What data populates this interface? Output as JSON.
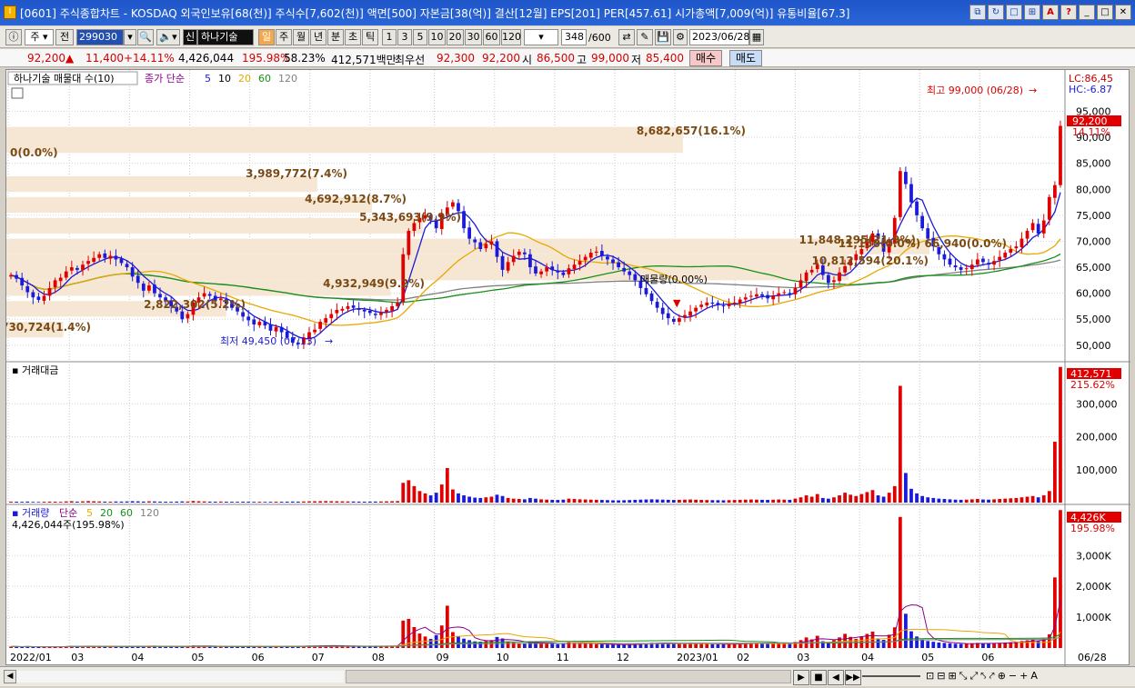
{
  "window": {
    "title": "[0601] 주식종합차트 - KOSDAQ 외국인보유[68(천)] 주식수[7,602(천)] 액면[500] 자본금[38(억)] 결산[12월] EPS[201] PER[457.61] 시가총액[7,009(억)] 유통비율[67.3]",
    "app_icon": "I"
  },
  "toolbar": {
    "type_select": "주",
    "prev_label": "전",
    "stock_code": "299030",
    "company_badge": "신",
    "company_name": "하나기술",
    "periods": [
      "일",
      "주",
      "월",
      "년",
      "분",
      "초",
      "틱"
    ],
    "active_period": "일",
    "intervals": [
      "1",
      "3",
      "5",
      "10",
      "20",
      "30",
      "60",
      "120"
    ],
    "count_value": "348",
    "count_max": "/600",
    "date_value": "2023/06/28"
  },
  "quote": {
    "price": "92,200",
    "change": "11,400",
    "change_pct": "+14.11%",
    "volume": "4,426,044",
    "volume_ratio": "195.98%",
    "turnover": "58.23%",
    "amount": "412,571백만",
    "best_label": "최우선",
    "best_ask": "92,300",
    "best_bid": "92,200",
    "open_label": "시",
    "open": "86,500",
    "high_label": "고",
    "high": "99,000",
    "low_label": "저",
    "low": "85,400",
    "buy_label": "매수",
    "sell_label": "매도"
  },
  "colors": {
    "up": "#e00000",
    "down": "#1a1ad8",
    "ma5": "#1a1ad8",
    "ma10": "#ffffff",
    "ma20": "#e8a800",
    "ma60": "#189018",
    "ma120": "#808080",
    "volume_profile": "#f6e7d5",
    "volume_profile_text": "#7a4a14"
  },
  "chart_data": [
    {
      "type": "candlestick",
      "title": "하나기술 매물대 수(10)",
      "legend": {
        "label": "종가 단순",
        "periods": [
          "5",
          "10",
          "20",
          "60",
          "120"
        ]
      },
      "price_axis_ticks": [
        "95,000",
        "90,000",
        "85,000",
        "80,000",
        "75,000",
        "70,000",
        "65,000",
        "60,000",
        "55,000",
        "50,000"
      ],
      "ylim": [
        47000,
        100500
      ],
      "x_month_labels": [
        "2022/01",
        "03",
        "04",
        "05",
        "06",
        "07",
        "08",
        "09",
        "10",
        "11",
        "12",
        "2023/01",
        "02",
        "03",
        "04",
        "05",
        "06"
      ],
      "x_right_label": "06/28",
      "last_price_label": "92,200",
      "last_pct_label": "14.11%",
      "lc_label": "LC:86,45",
      "hc_label": "HC:-6.87",
      "annotations": {
        "high": "최고 99,000 (06/28)",
        "low": "최저 49,450 (07/13)",
        "vp_current": "매물량(0.00%)"
      },
      "volume_profile": [
        {
          "label": "0(0.0%)",
          "lo": 87000,
          "hi": 92000,
          "value": 0
        },
        {
          "label": "8,682,657(16.1%)",
          "lo": 87000,
          "hi": 92000,
          "value": 8682657
        },
        {
          "label": "3,989,772(7.4%)",
          "lo": 79500,
          "hi": 82500,
          "value": 3989772
        },
        {
          "label": "4,692,912(8.7%)",
          "lo": 75500,
          "hi": 78500,
          "value": 4692912
        },
        {
          "label": "5,343,693(9.9%)",
          "lo": 71500,
          "hi": 74500,
          "value": 5343693
        },
        {
          "label": "11,848,295(21.9%)",
          "lo": 67500,
          "hi": 70500,
          "value": 11848295
        },
        {
          "label": "10,812,594(20.1%)",
          "lo": 62500,
          "hi": 67500,
          "value": 10812594
        },
        {
          "label": "4,932,949(9.2%)",
          "lo": 59500,
          "hi": 62500,
          "value": 4932949
        },
        {
          "label": "2,822,302(5.2%)",
          "lo": 55500,
          "hi": 58500,
          "value": 2822302
        },
        {
          "label": "730,724(1.4%)",
          "lo": 51500,
          "hi": 54500,
          "value": 730724
        }
      ],
      "vp_mid_label": "11,150(0.0%) 66,940(0.0%)",
      "closes": [
        63500,
        62800,
        61500,
        60200,
        59200,
        58700,
        59500,
        61000,
        62500,
        63000,
        64200,
        65000,
        64500,
        65500,
        66200,
        66800,
        67500,
        66800,
        67200,
        66500,
        65800,
        65000,
        63200,
        62000,
        60500,
        61500,
        60000,
        59200,
        58500,
        57500,
        56500,
        55000,
        56000,
        58200,
        59200,
        60000,
        59500,
        58500,
        59000,
        58000,
        57200,
        56500,
        55500,
        54800,
        54000,
        54500,
        53800,
        52800,
        53500,
        52500,
        51500,
        50500,
        50200,
        51500,
        52500,
        53000,
        54500,
        55200,
        56000,
        56800,
        57000,
        57500,
        57200,
        56800,
        56500,
        56200,
        55800,
        56200,
        56800,
        57500,
        58200,
        67500,
        72000,
        73500,
        74500,
        75000,
        74000,
        72500,
        75200,
        76500,
        77500,
        75800,
        72500,
        70500,
        69800,
        68500,
        69500,
        70000,
        67000,
        64500,
        66000,
        67200,
        68000,
        67500,
        65000,
        63800,
        64200,
        65000,
        64500,
        64000,
        63500,
        64800,
        65500,
        66200,
        67000,
        67800,
        68000,
        67200,
        66500,
        65800,
        65000,
        64200,
        63500,
        62500,
        61000,
        59800,
        58500,
        57200,
        56000,
        55200,
        54500,
        55200,
        55800,
        56500,
        57200,
        57800,
        58200,
        58000,
        57800,
        57500,
        58000,
        58200,
        58800,
        59200,
        59500,
        59800,
        59500,
        59000,
        59500,
        60000,
        60200,
        59800,
        61000,
        62500,
        64000,
        64500,
        65500,
        63500,
        62000,
        62500,
        64000,
        65200,
        66500,
        67500,
        68500,
        70000,
        71500,
        70500,
        68000,
        69500,
        74500,
        83500,
        81000,
        77500,
        75000,
        72500,
        70500,
        69000,
        67500,
        66500,
        65500,
        65000,
        64500,
        64800,
        65500,
        66500,
        66000,
        65500,
        66200,
        67000,
        67800,
        68500,
        69000,
        70500,
        72000,
        73500,
        71500,
        74000,
        78500,
        80800,
        92200
      ]
    },
    {
      "type": "bar",
      "title": "거래대금",
      "axis_ticks": [
        "300,000",
        "200,000",
        "100,000"
      ],
      "ylim": [
        0,
        420000
      ],
      "last_value_label": "412,571",
      "last_pct_label": "215.62%",
      "values": [
        3000,
        2800,
        2500,
        3200,
        2200,
        2000,
        2600,
        3100,
        2900,
        2400,
        3600,
        4200,
        3000,
        3800,
        4500,
        4000,
        3500,
        3000,
        2800,
        3300,
        3100,
        3500,
        4200,
        3800,
        3200,
        3900,
        3500,
        3000,
        2800,
        2600,
        3100,
        3600,
        3300,
        4800,
        4000,
        3500,
        3000,
        2900,
        3200,
        2800,
        2600,
        2500,
        2900,
        2700,
        2400,
        2600,
        2300,
        2500,
        2800,
        2600,
        2900,
        3200,
        3000,
        3400,
        3800,
        4000,
        4200,
        4500,
        4200,
        4000,
        3800,
        3500,
        3300,
        3000,
        2800,
        3000,
        3200,
        3500,
        3800,
        4200,
        4500,
        60000,
        68000,
        50000,
        35000,
        28000,
        22000,
        30000,
        55000,
        105000,
        40000,
        28000,
        22000,
        18000,
        15000,
        14000,
        16000,
        18000,
        24000,
        20000,
        14000,
        12000,
        11000,
        10000,
        14000,
        12000,
        10000,
        9000,
        8500,
        8000,
        9000,
        12000,
        11000,
        10000,
        9500,
        9000,
        8500,
        8000,
        7500,
        7000,
        6800,
        7200,
        7800,
        8500,
        9000,
        9500,
        10000,
        9500,
        9000,
        8500,
        8000,
        8500,
        9000,
        9500,
        8800,
        8200,
        7800,
        7500,
        7200,
        7000,
        7500,
        8000,
        8500,
        9000,
        9500,
        9000,
        8500,
        8200,
        8800,
        9500,
        9000,
        8500,
        12000,
        16000,
        22000,
        18000,
        26000,
        14000,
        12000,
        16000,
        22000,
        30000,
        24000,
        20000,
        26000,
        32000,
        38000,
        22000,
        18000,
        30000,
        50000,
        355000,
        90000,
        42000,
        28000,
        20000,
        16000,
        14000,
        12000,
        11000,
        10000,
        9000,
        8500,
        9000,
        10000,
        11000,
        9500,
        9000,
        10000,
        11000,
        12000,
        13000,
        14000,
        16000,
        18000,
        20000,
        16000,
        22000,
        35000,
        185000,
        412571
      ]
    },
    {
      "type": "bar",
      "title": "거래량",
      "legend": {
        "label": "단순",
        "periods": [
          "5",
          "20",
          "60",
          "120"
        ]
      },
      "sub_label": "4,426,044주(195.98%)",
      "axis_ticks": [
        "3,000K",
        "2,000K",
        "1,000K"
      ],
      "ylim": [
        0,
        4600000
      ],
      "last_value_label": "4,426K",
      "last_pct_label": "195.98%"
    }
  ],
  "bottombar": {
    "controls": [
      "◀",
      "▶",
      "■",
      "◀",
      "▶▶"
    ],
    "zoom_buttons": [
      "−",
      "+",
      "A"
    ]
  }
}
